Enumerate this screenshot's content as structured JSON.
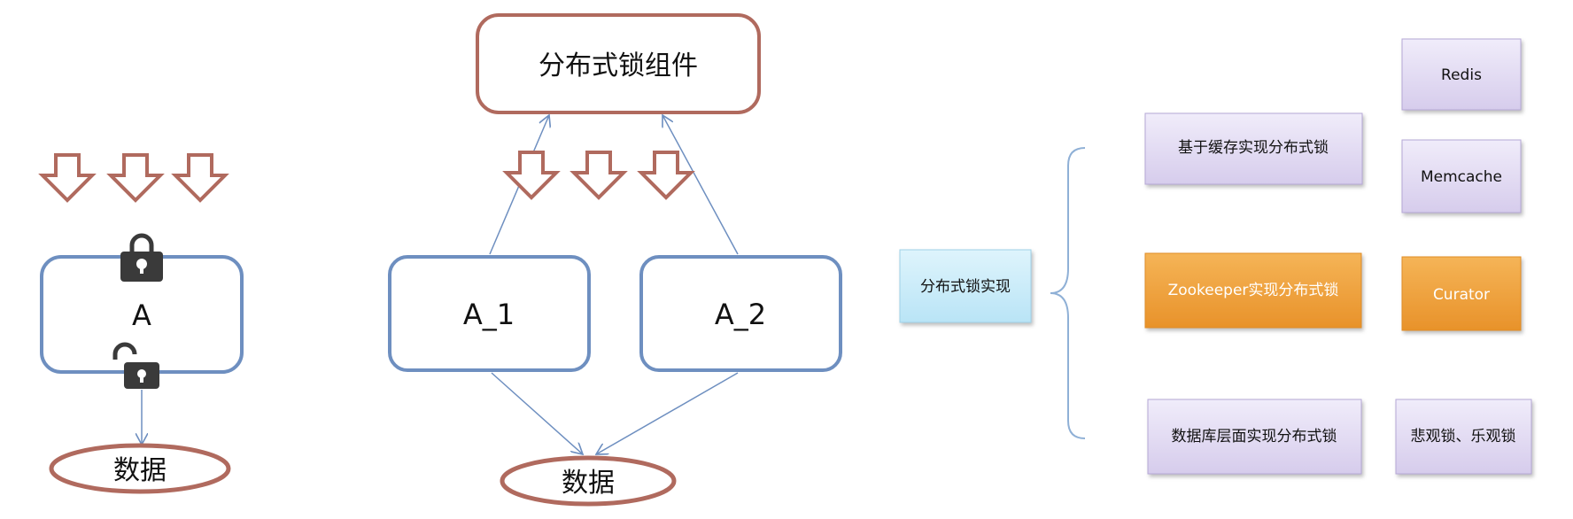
{
  "left_diagram": {
    "node_label": "A",
    "data_label": "数据"
  },
  "middle_diagram": {
    "component_label": "分布式锁组件",
    "node1_label": "A_1",
    "node2_label": "A_2",
    "data_label": "数据"
  },
  "tree": {
    "root": "分布式锁实现",
    "branches": [
      {
        "label": "基于缓存实现分布式锁",
        "children": [
          "Redis",
          "Memcache"
        ]
      },
      {
        "label": "Zookeeper实现分布式锁",
        "children": [
          "Curator"
        ]
      },
      {
        "label": "数据库层面实现分布式锁",
        "children": [
          "悲观锁、乐观锁"
        ]
      }
    ]
  },
  "colors": {
    "node_border": "#6e8fc0",
    "ellipse_border": "#b06a5e",
    "arrow_fill": "#ffffff",
    "arrow_border": "#b06a5e",
    "lock_fill": "#3a3a3a",
    "root_fill": "#c6eaf8",
    "purple_fill": "#e2dcf1",
    "orange_fill": "#f0a43b",
    "brace": "#8fb0d6",
    "connector": "#6e8fc0"
  }
}
